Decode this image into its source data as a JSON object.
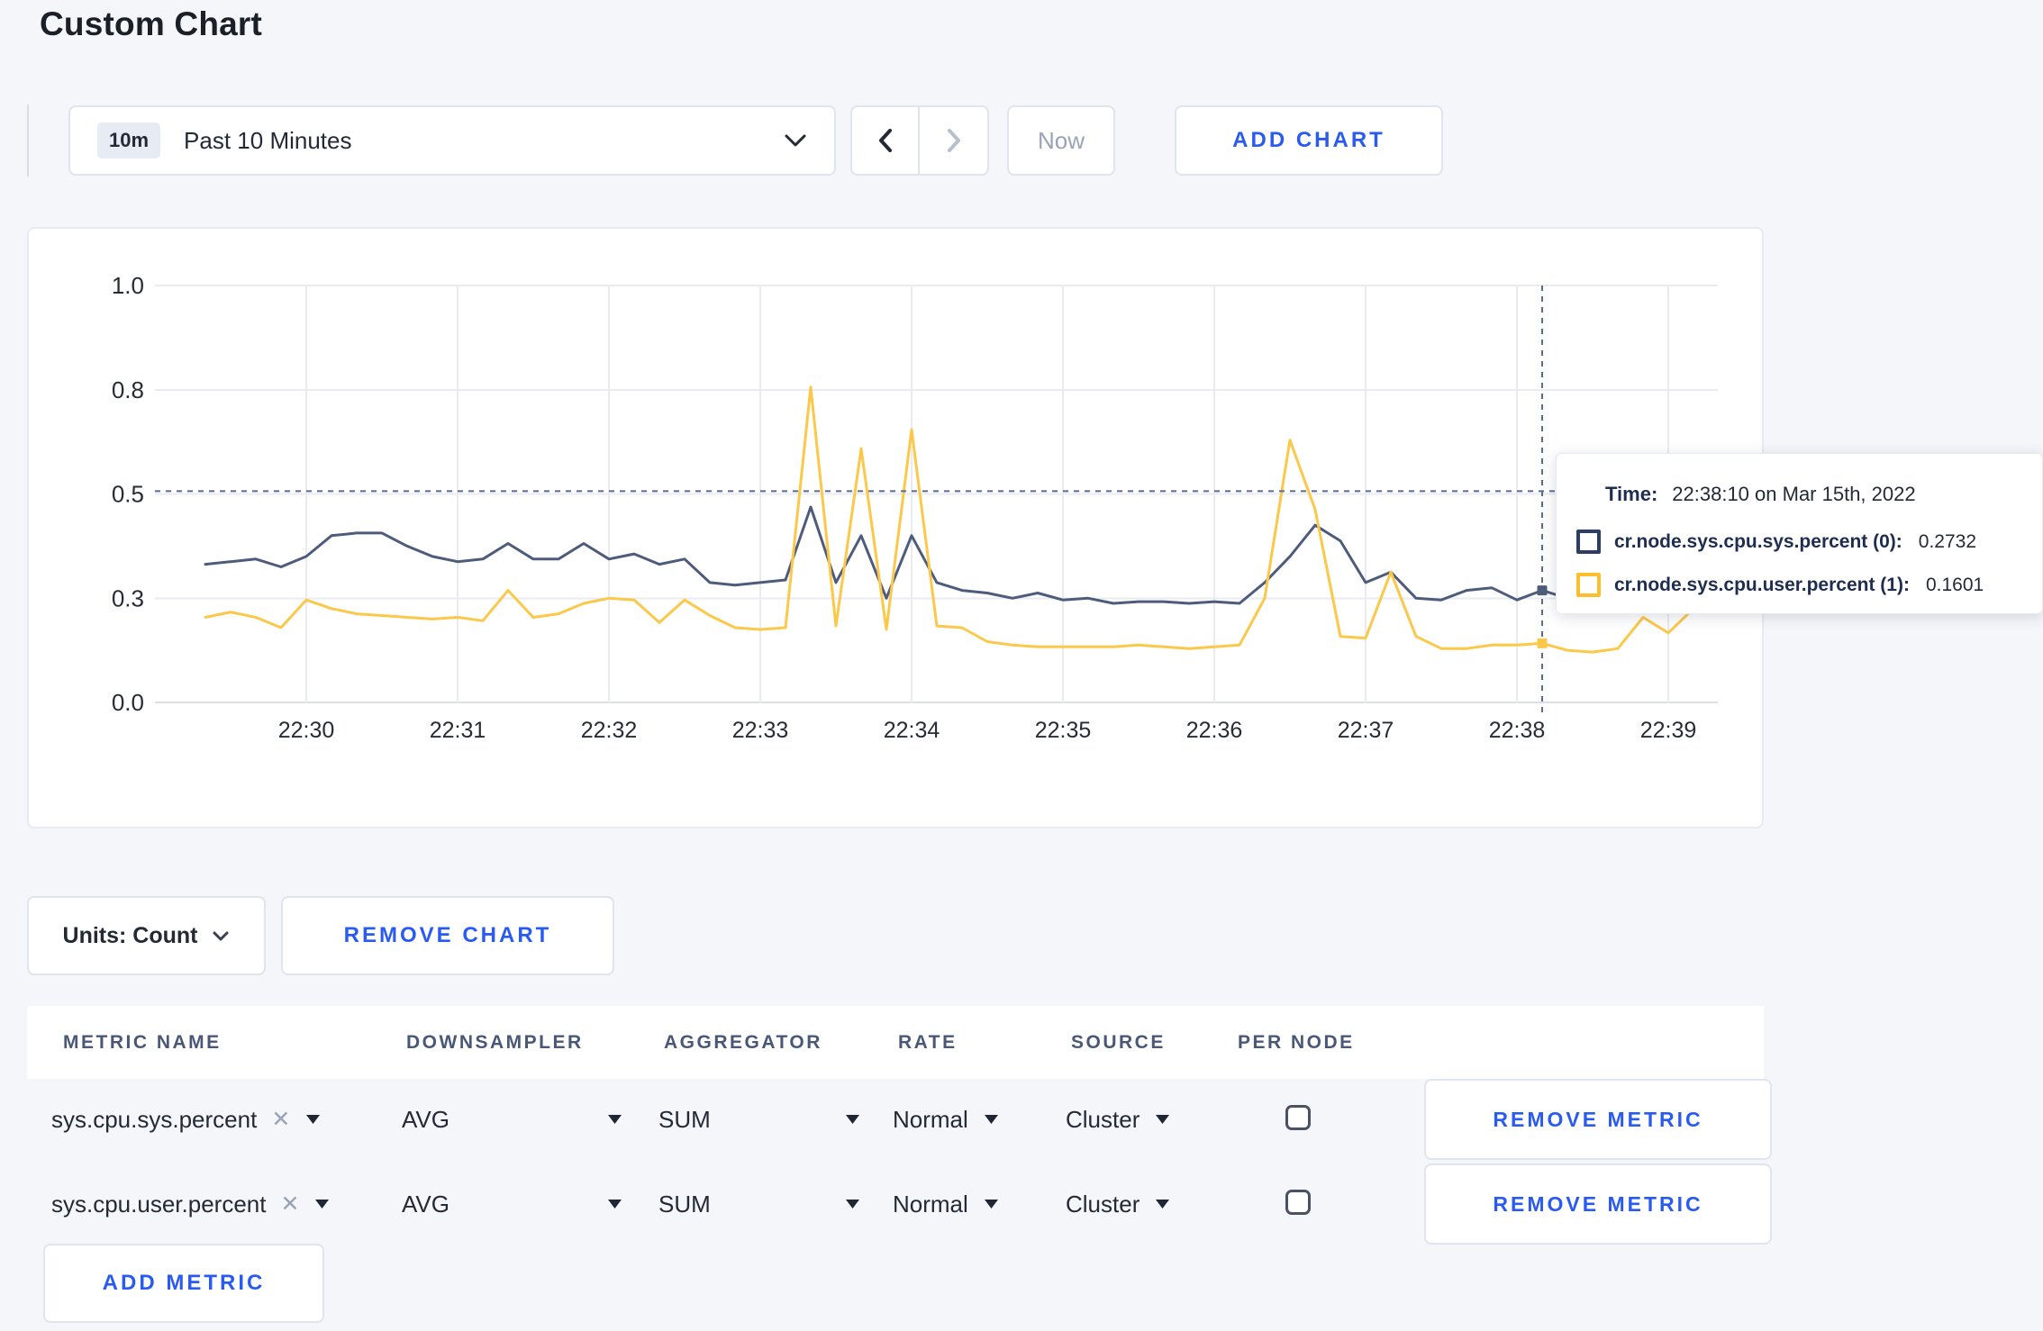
{
  "page": {
    "title": "Custom Chart"
  },
  "toolbar": {
    "time_badge": "10m",
    "time_label": "Past 10 Minutes",
    "now_label": "Now",
    "add_chart_label": "ADD CHART"
  },
  "tooltip": {
    "time_label": "Time:",
    "time_value": "22:38:10 on Mar 15th, 2022",
    "series": [
      {
        "label": "cr.node.sys.cpu.sys.percent (0):",
        "value": "0.2732",
        "color": "#2c3e63"
      },
      {
        "label": "cr.node.sys.cpu.user.percent (1):",
        "value": "0.1601",
        "color": "#fdbe2d"
      }
    ]
  },
  "chart_data": {
    "type": "line",
    "title": "",
    "xlabel": "",
    "ylabel": "",
    "ylim": [
      0,
      1.0
    ],
    "grid": true,
    "y_ticks": [
      0,
      0.3,
      0.5,
      0.8,
      1.0
    ],
    "y_tick_labels": [
      "0.0",
      "0.3",
      "0.5",
      "0.8",
      "1.0"
    ],
    "x_tick_labels": [
      "22:30",
      "22:31",
      "22:32",
      "22:33",
      "22:34",
      "22:35",
      "22:36",
      "22:37",
      "22:38",
      "22:39"
    ],
    "start_time": "22:29:20",
    "interval_seconds": 10,
    "crosshair_time": "22:38:10",
    "crosshair_value": 0.508,
    "series": [
      {
        "name": "cr.node.sys.cpu.sys.percent",
        "color": "#4e5c7c",
        "values": [
          0.365,
          0.37,
          0.375,
          0.36,
          0.38,
          0.42,
          0.425,
          0.425,
          0.4,
          0.38,
          0.37,
          0.375,
          0.405,
          0.375,
          0.375,
          0.405,
          0.375,
          0.385,
          0.365,
          0.375,
          0.33,
          0.325,
          0.33,
          0.335,
          0.475,
          0.33,
          0.42,
          0.3,
          0.42,
          0.33,
          0.315,
          0.31,
          0.3,
          0.31,
          0.295,
          0.3,
          0.285,
          0.29,
          0.29,
          0.285,
          0.29,
          0.285,
          0.33,
          0.38,
          0.44,
          0.41,
          0.33,
          0.35,
          0.3,
          0.295,
          0.315,
          0.32,
          0.295,
          0.315,
          0.3,
          0.3,
          0.3,
          0.3,
          0.305,
          0.3
        ]
      },
      {
        "name": "cr.node.sys.cpu.user.percent",
        "color": "#fcc84a",
        "values": [
          0.245,
          0.26,
          0.245,
          0.215,
          0.295,
          0.27,
          0.255,
          0.25,
          0.245,
          0.24,
          0.245,
          0.235,
          0.315,
          0.245,
          0.255,
          0.285,
          0.3,
          0.295,
          0.23,
          0.295,
          0.25,
          0.215,
          0.21,
          0.215,
          0.805,
          0.22,
          0.63,
          0.21,
          0.685,
          0.22,
          0.215,
          0.175,
          0.165,
          0.16,
          0.16,
          0.16,
          0.16,
          0.165,
          0.16,
          0.155,
          0.16,
          0.165,
          0.3,
          0.655,
          0.47,
          0.19,
          0.185,
          0.35,
          0.19,
          0.155,
          0.155,
          0.165,
          0.165,
          0.17,
          0.15,
          0.145,
          0.155,
          0.245,
          0.2,
          0.27
        ]
      }
    ]
  },
  "units": {
    "label": "Units: Count",
    "remove_chart_label": "REMOVE CHART"
  },
  "metrics_table": {
    "headers": [
      "METRIC NAME",
      "DOWNSAMPLER",
      "AGGREGATOR",
      "RATE",
      "SOURCE",
      "PER NODE"
    ],
    "rows": [
      {
        "metric_name": "sys.cpu.sys.percent",
        "close": "✕",
        "downsampler": "AVG",
        "aggregator": "SUM",
        "rate": "Normal",
        "source": "Cluster",
        "per_node_checked": false,
        "remove_label": "REMOVE METRIC"
      },
      {
        "metric_name": "sys.cpu.user.percent",
        "close": "✕",
        "downsampler": "AVG",
        "aggregator": "SUM",
        "rate": "Normal",
        "source": "Cluster",
        "per_node_checked": false,
        "remove_label": "REMOVE METRIC"
      }
    ],
    "add_metric_label": "ADD METRIC"
  },
  "colors": {
    "accent_blue": "#2a5bf0",
    "page_bg": "#f4f6fa",
    "grid_line": "#e9ebf1",
    "axis_line": "#dcdfe7",
    "crosshair": "#5b6b8c",
    "text_dark": "#242a35",
    "header_text": "#4a5878"
  }
}
